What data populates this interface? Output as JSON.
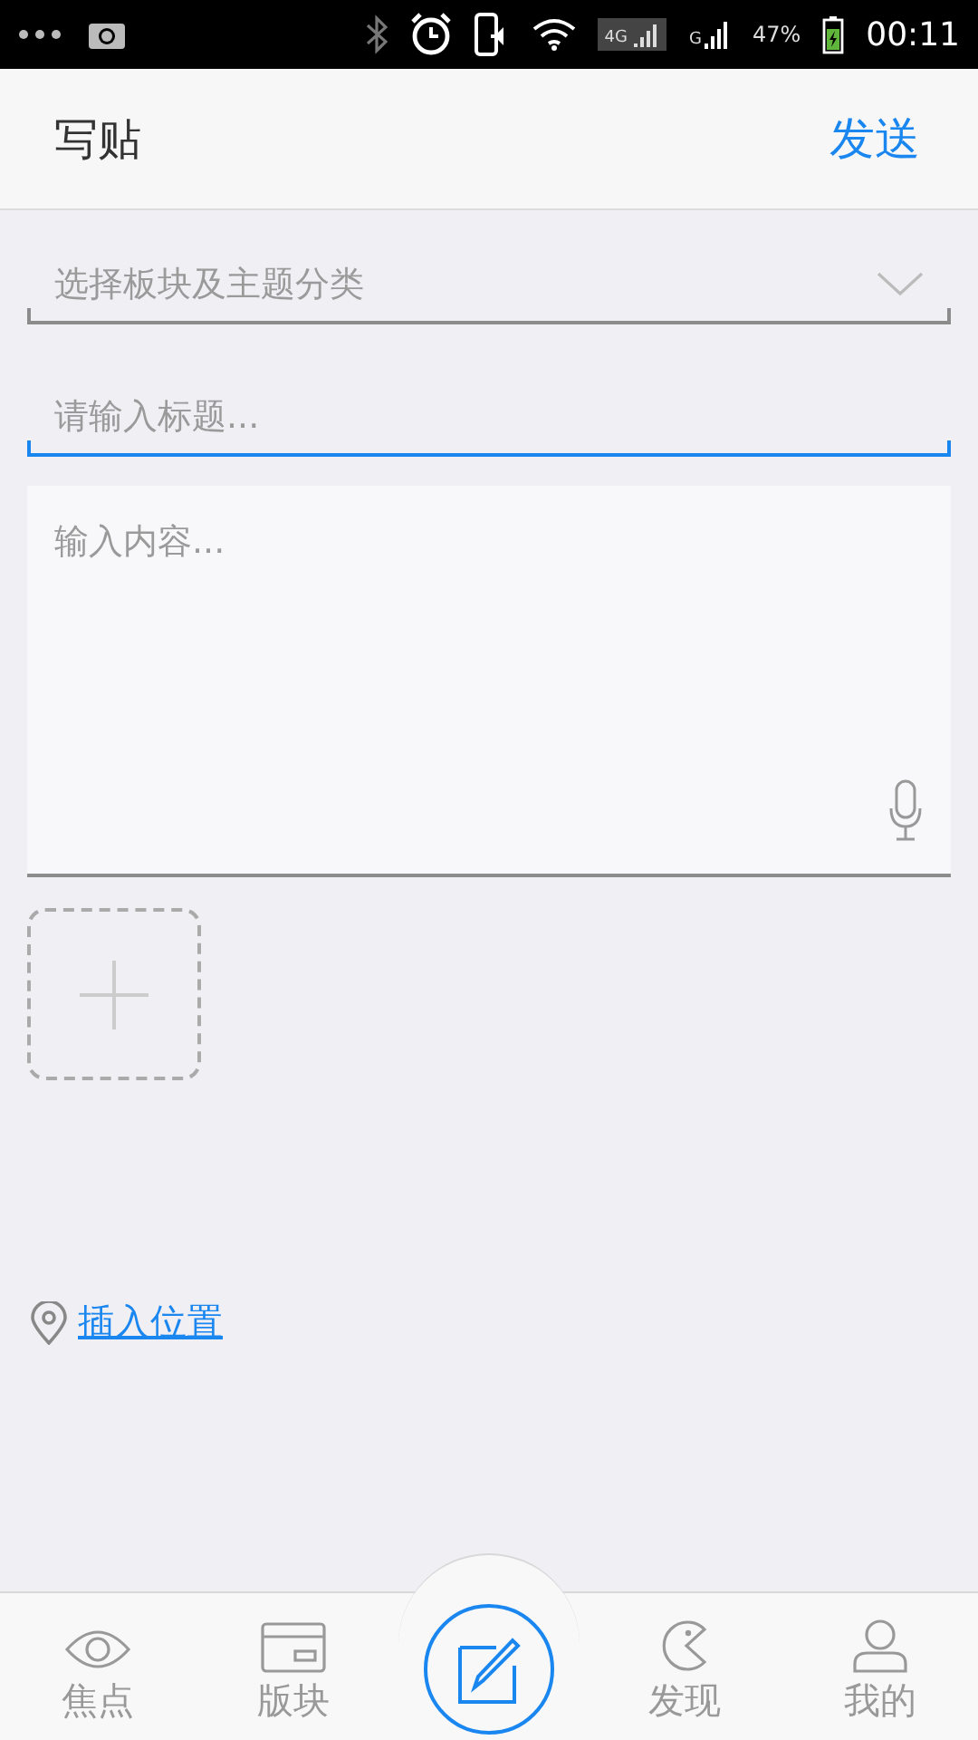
{
  "status_bar": {
    "network_labels": [
      "4G",
      "G"
    ],
    "battery": "47%",
    "time": "00:11"
  },
  "header": {
    "title": "写贴",
    "action": "发送"
  },
  "form": {
    "category": {
      "placeholder": "选择板块及主题分类"
    },
    "title": {
      "placeholder": "请输入标题...",
      "focused": true
    },
    "content": {
      "placeholder": "输入内容..."
    }
  },
  "location": {
    "label": "插入位置"
  },
  "bottom_nav": [
    {
      "label": "焦点",
      "kind": "tab"
    },
    {
      "label": "版块",
      "kind": "tab"
    },
    {
      "kind": "center"
    },
    {
      "label": "发现",
      "kind": "tab"
    },
    {
      "label": "我的",
      "kind": "tab"
    }
  ]
}
